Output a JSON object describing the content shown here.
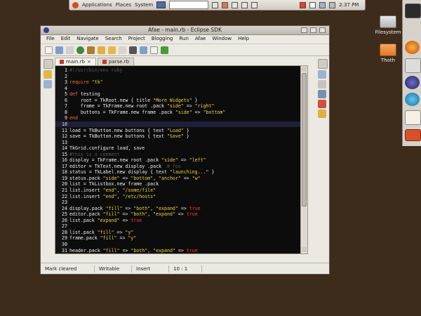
{
  "top_panel": {
    "menus": [
      "Applications",
      "Places",
      "System"
    ],
    "clock": "2:37 PM"
  },
  "desktop_icons": [
    {
      "label": "Filesystem",
      "icon": "drive-icon"
    },
    {
      "label": "Thoth",
      "icon": "home-folder-icon"
    }
  ],
  "window": {
    "title": "Afae - main.rb - Eclipse SDK",
    "menu": [
      "File",
      "Edit",
      "Navigate",
      "Search",
      "Project",
      "Blogging",
      "Run",
      "Afae",
      "Window",
      "Help"
    ],
    "tabs": [
      {
        "label": "main.rb",
        "active": true
      },
      {
        "label": "parse.rb",
        "active": false
      }
    ],
    "status": {
      "message": "Mark cleared",
      "writable": "Writable",
      "insert": "Insert",
      "position": "10 : 1"
    }
  },
  "code": [
    {
      "n": "1",
      "parts": [
        [
          "#!/usr/bin/env ruby",
          "#565656"
        ]
      ]
    },
    {
      "n": "2",
      "parts": []
    },
    {
      "n": "3",
      "parts": [
        [
          "require ",
          "#ff6a2f"
        ],
        [
          "\"tk\"",
          "#f2d23a"
        ]
      ]
    },
    {
      "n": "4",
      "parts": []
    },
    {
      "n": "5",
      "parts": [
        [
          "def ",
          "#ff6a2f"
        ],
        [
          "testing",
          "#f0f0f0"
        ]
      ]
    },
    {
      "n": "6",
      "parts": [
        [
          "    root = TkRoot.new { title ",
          "#f0f0f0"
        ],
        [
          "\"More Widgets\"",
          "#f2d23a"
        ],
        [
          " }",
          "#f0f0f0"
        ]
      ]
    },
    {
      "n": "7",
      "parts": [
        [
          "    frame = TkFrame.new root .pack ",
          "#f0f0f0"
        ],
        [
          "\"side\"",
          "#f2d23a"
        ],
        [
          " => ",
          "#f0f0f0"
        ],
        [
          "\"right\"",
          "#f2d23a"
        ]
      ]
    },
    {
      "n": "8",
      "parts": [
        [
          "    buttons = TkFrame.new frame .pack ",
          "#f0f0f0"
        ],
        [
          "\"side\"",
          "#f2d23a"
        ],
        [
          " => ",
          "#f0f0f0"
        ],
        [
          "\"bottom\"",
          "#f2d23a"
        ]
      ]
    },
    {
      "n": "9",
      "parts": [
        [
          "end",
          "#ff6a2f"
        ]
      ]
    },
    {
      "n": "10",
      "parts": [],
      "current": true
    },
    {
      "n": "11",
      "parts": [
        [
          "load = TkButton.new buttons { text ",
          "#f0f0f0"
        ],
        [
          "\"Load\"",
          "#f2d23a"
        ],
        [
          " }",
          "#f0f0f0"
        ]
      ]
    },
    {
      "n": "12",
      "parts": [
        [
          "save = TkButton.new buttons { text ",
          "#f0f0f0"
        ],
        [
          "\"Save\"",
          "#f2d23a"
        ],
        [
          " }",
          "#f0f0f0"
        ]
      ]
    },
    {
      "n": "13",
      "parts": []
    },
    {
      "n": "14",
      "parts": [
        [
          "TkGrid.configure load, save",
          "#f0f0f0"
        ]
      ]
    },
    {
      "n": "15",
      "parts": [
        [
          "#this is a comment",
          "#565656"
        ]
      ]
    },
    {
      "n": "16",
      "parts": [
        [
          "display = TkFrame.new root .pack ",
          "#f0f0f0"
        ],
        [
          "\"side\"",
          "#f2d23a"
        ],
        [
          " => ",
          "#f0f0f0"
        ],
        [
          "\"left\"",
          "#f2d23a"
        ]
      ]
    },
    {
      "n": "17",
      "parts": [
        [
          "editor = TkText.new display .pack  ",
          "#f0f0f0"
        ],
        [
          "# foo",
          "#565656"
        ]
      ]
    },
    {
      "n": "18",
      "parts": [
        [
          "status = TkLabel.new display { text ",
          "#f0f0f0"
        ],
        [
          "\"launching...\"",
          "#f2d23a"
        ],
        [
          " }",
          "#f0f0f0"
        ]
      ]
    },
    {
      "n": "19",
      "parts": [
        [
          "status.pack ",
          "#f0f0f0"
        ],
        [
          "\"side\"",
          "#f2d23a"
        ],
        [
          " => ",
          "#f0f0f0"
        ],
        [
          "\"bottom\"",
          "#f2d23a"
        ],
        [
          ", ",
          "#f0f0f0"
        ],
        [
          "\"anchor\"",
          "#f2d23a"
        ],
        [
          " => ",
          "#f0f0f0"
        ],
        [
          "\"w\"",
          "#f2d23a"
        ]
      ]
    },
    {
      "n": "20",
      "parts": [
        [
          "list = TkListbox.new frame .pack",
          "#f0f0f0"
        ]
      ]
    },
    {
      "n": "21",
      "parts": [
        [
          "list.insert ",
          "#f0f0f0"
        ],
        [
          "\"end\"",
          "#f2d23a"
        ],
        [
          ", ",
          "#f0f0f0"
        ],
        [
          "\"/some/file\"",
          "#f2d23a"
        ]
      ]
    },
    {
      "n": "22",
      "parts": [
        [
          "list.insert ",
          "#f0f0f0"
        ],
        [
          "\"end\"",
          "#f2d23a"
        ],
        [
          ", ",
          "#f0f0f0"
        ],
        [
          "\"/etc/hosts\"",
          "#f2d23a"
        ]
      ]
    },
    {
      "n": "23",
      "parts": []
    },
    {
      "n": "24",
      "parts": [
        [
          "display.pack ",
          "#f0f0f0"
        ],
        [
          "\"fill\"",
          "#f2d23a"
        ],
        [
          " => ",
          "#f0f0f0"
        ],
        [
          "\"both\"",
          "#f2d23a"
        ],
        [
          ", ",
          "#f0f0f0"
        ],
        [
          "\"expand\"",
          "#f2d23a"
        ],
        [
          " => ",
          "#f0f0f0"
        ],
        [
          "true",
          "#ff3b2f"
        ]
      ]
    },
    {
      "n": "25",
      "parts": [
        [
          "editor.pack ",
          "#f0f0f0"
        ],
        [
          "\"fill\"",
          "#f2d23a"
        ],
        [
          " => ",
          "#f0f0f0"
        ],
        [
          "\"both\"",
          "#f2d23a"
        ],
        [
          ", ",
          "#f0f0f0"
        ],
        [
          "\"expand\"",
          "#f2d23a"
        ],
        [
          " => ",
          "#f0f0f0"
        ],
        [
          "true",
          "#ff3b2f"
        ]
      ]
    },
    {
      "n": "26",
      "parts": [
        [
          "list.pack ",
          "#f0f0f0"
        ],
        [
          "\"expand\"",
          "#f2d23a"
        ],
        [
          " => ",
          "#f0f0f0"
        ],
        [
          "true",
          "#ff3b2f"
        ]
      ]
    },
    {
      "n": "27",
      "parts": []
    },
    {
      "n": "28",
      "parts": [
        [
          "list.pack ",
          "#f0f0f0"
        ],
        [
          "\"fill\"",
          "#f2d23a"
        ],
        [
          " => ",
          "#f0f0f0"
        ],
        [
          "\"y\"",
          "#f2d23a"
        ]
      ]
    },
    {
      "n": "29",
      "parts": [
        [
          "frame.pack ",
          "#f0f0f0"
        ],
        [
          "\"fill\"",
          "#f2d23a"
        ],
        [
          " => ",
          "#f0f0f0"
        ],
        [
          "\"y\"",
          "#f2d23a"
        ]
      ]
    },
    {
      "n": "30",
      "parts": []
    },
    {
      "n": "31",
      "parts": [
        [
          "header.pack ",
          "#f0f0f0"
        ],
        [
          "\"fill\"",
          "#f2d23a"
        ],
        [
          " => ",
          "#f0f0f0"
        ],
        [
          "\"both\"",
          "#f2d23a"
        ],
        [
          ", ",
          "#f0f0f0"
        ],
        [
          "\"expand\"",
          "#f2d23a"
        ],
        [
          " => ",
          "#f0f0f0"
        ],
        [
          "true",
          "#ff3b2f"
        ]
      ]
    }
  ]
}
